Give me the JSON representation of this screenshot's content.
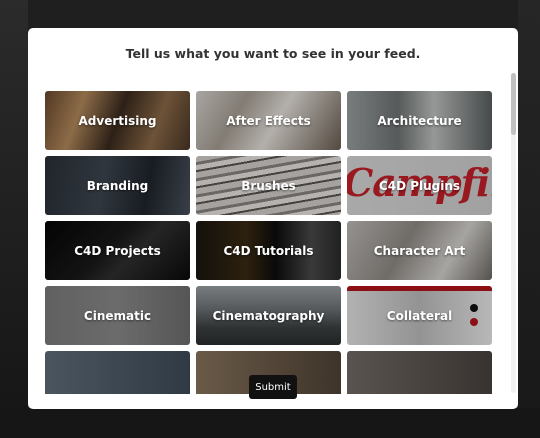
{
  "modal": {
    "title": "Tell us what you want to see in your feed.",
    "submit_label": "Submit"
  },
  "topics": [
    {
      "label": "Advertising",
      "bg": "advertising"
    },
    {
      "label": "After Effects",
      "bg": "aftereffects"
    },
    {
      "label": "Architecture",
      "bg": "architecture"
    },
    {
      "label": "Branding",
      "bg": "branding"
    },
    {
      "label": "Brushes",
      "bg": "brushes"
    },
    {
      "label": "C4D Plugins",
      "bg": "c4dplugins"
    },
    {
      "label": "C4D Projects",
      "bg": "c4dprojects"
    },
    {
      "label": "C4D Tutorials",
      "bg": "c4dtutorials"
    },
    {
      "label": "Character Art",
      "bg": "characterart"
    },
    {
      "label": "Cinematic",
      "bg": "cinematic"
    },
    {
      "label": "Cinematography",
      "bg": "cinematography"
    },
    {
      "label": "Collateral",
      "bg": "collateral"
    }
  ],
  "decor": {
    "c4d_plugins_image_text": "Campfire"
  },
  "colors": {
    "submit_bg": "#111111",
    "accent_red": "#c4202a"
  }
}
